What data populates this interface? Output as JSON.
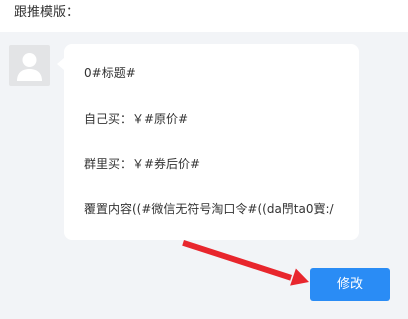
{
  "section_label": "跟推模版：",
  "message": {
    "lines": [
      "0#标题#",
      "自己买：￥#原价#",
      "群里买：￥#券后价#",
      "覆置内容((#微信无符号淘口令#((da閅ta0寳:/"
    ]
  },
  "edit_button": {
    "label": "修改"
  },
  "colors": {
    "panel_bg": "#f2f4f7",
    "button_bg": "#2a8cf5",
    "arrow": "#e8262d"
  },
  "icons": {
    "avatar": "user-icon"
  }
}
